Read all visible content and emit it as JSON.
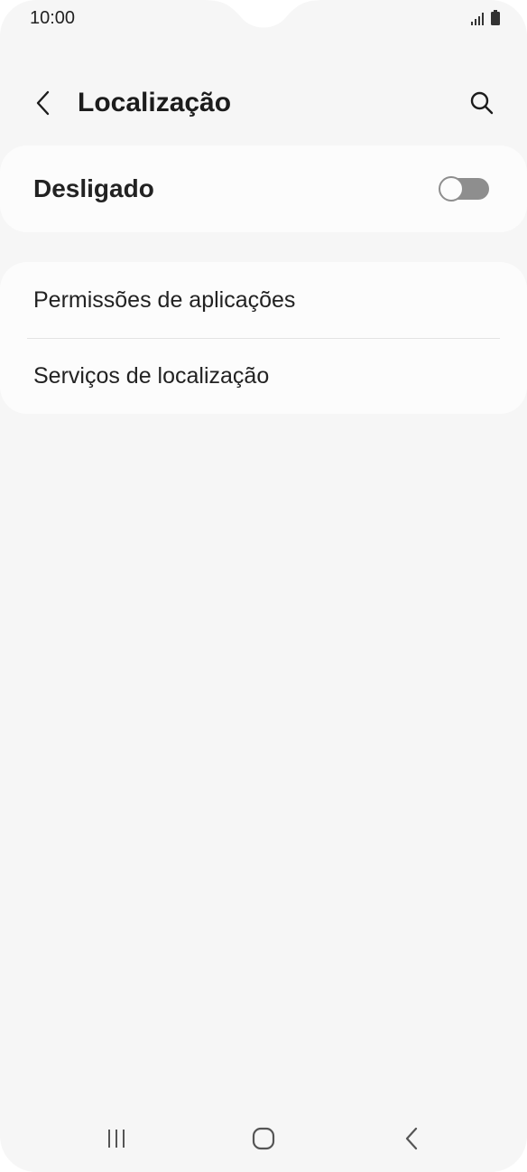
{
  "status_bar": {
    "time": "10:00",
    "icons": [
      "signal-icon",
      "battery-icon"
    ]
  },
  "header": {
    "title": "Localização",
    "back_icon": "chevron-left-icon",
    "search_icon": "search-icon"
  },
  "master_toggle": {
    "label": "Desligado",
    "state": "off"
  },
  "list": {
    "items": [
      {
        "label": "Permissões de aplicações"
      },
      {
        "label": "Serviços de localização"
      }
    ]
  },
  "nav_bar": {
    "icons": [
      "recents-icon",
      "home-icon",
      "back-icon"
    ]
  },
  "colors": {
    "background": "#f6f6f6",
    "card": "#fcfcfc",
    "switch_off": "#8e8e8e",
    "text": "#222222"
  }
}
